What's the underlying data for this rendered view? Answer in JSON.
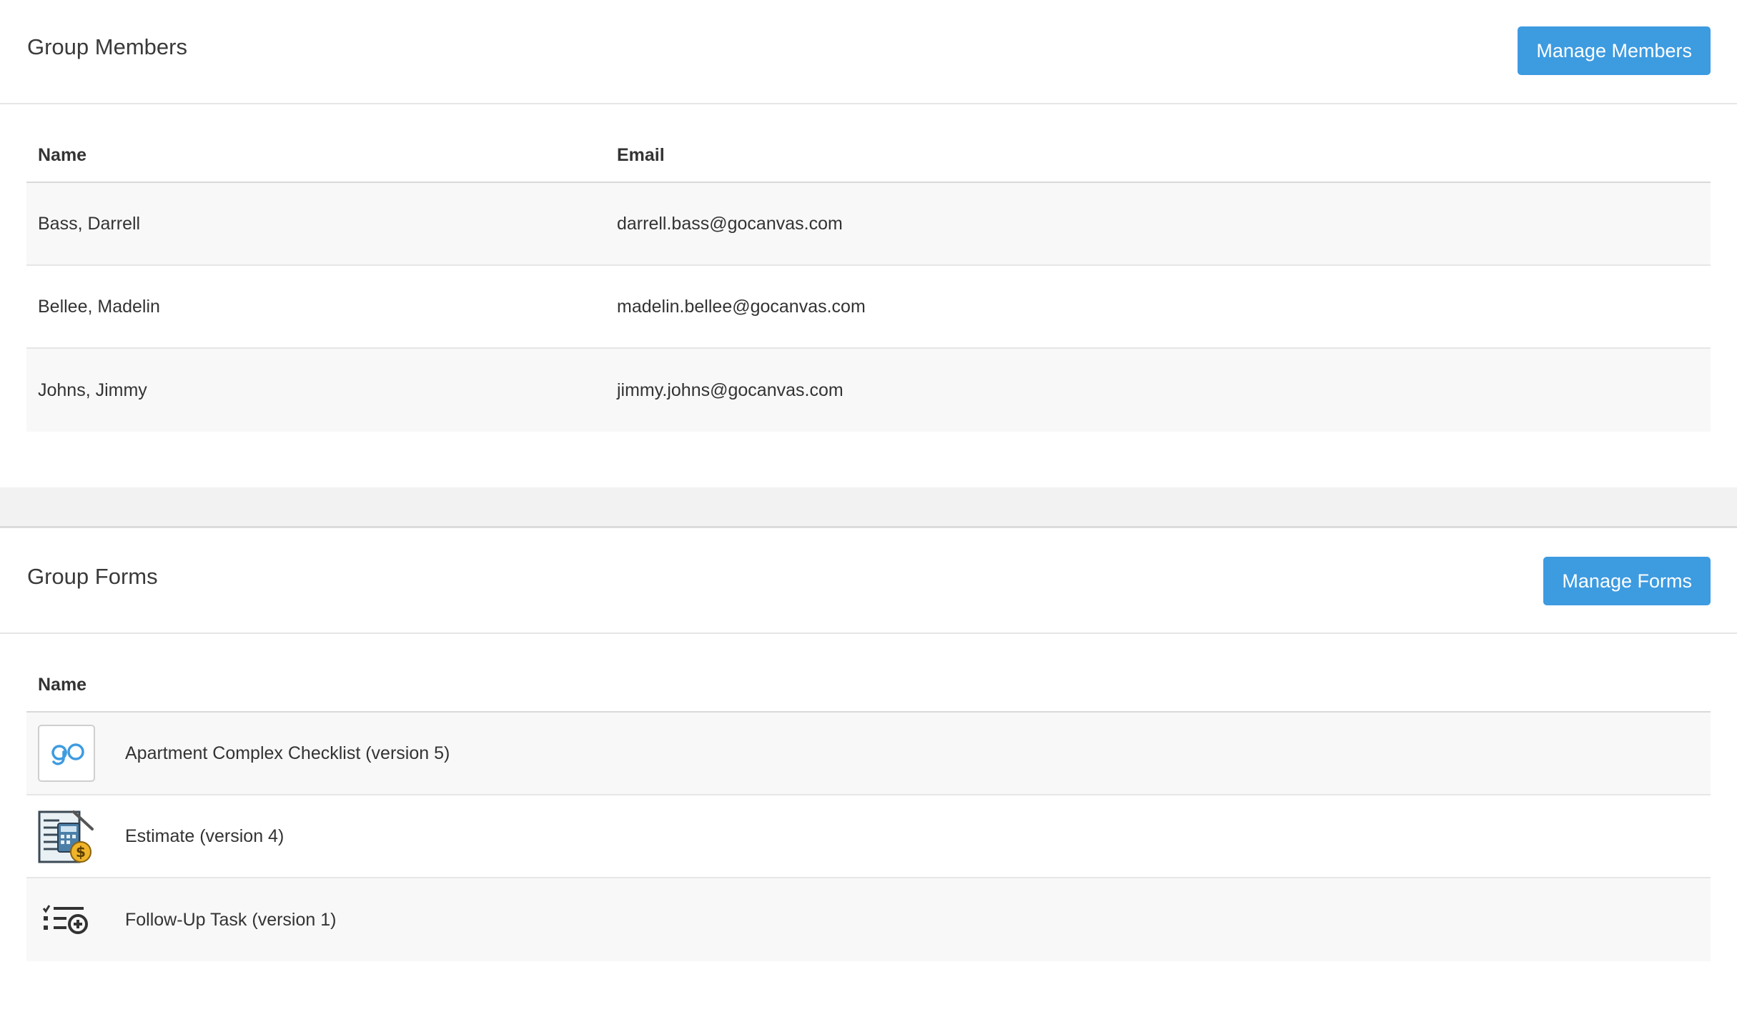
{
  "members": {
    "title": "Group Members",
    "manage_label": "Manage Members",
    "columns": {
      "name": "Name",
      "email": "Email"
    },
    "rows": [
      {
        "name": "Bass, Darrell",
        "email": "darrell.bass@gocanvas.com"
      },
      {
        "name": "Bellee, Madelin",
        "email": "madelin.bellee@gocanvas.com"
      },
      {
        "name": "Johns, Jimmy",
        "email": "jimmy.johns@gocanvas.com"
      }
    ]
  },
  "forms": {
    "title": "Group Forms",
    "manage_label": "Manage Forms",
    "columns": {
      "name": "Name"
    },
    "rows": [
      {
        "icon": "gocanvas-logo-icon",
        "name": "Apartment Complex Checklist (version 5)"
      },
      {
        "icon": "calculator-estimate-icon",
        "name": "Estimate (version 4)"
      },
      {
        "icon": "task-list-add-icon",
        "name": "Follow-Up Task (version 1)"
      }
    ]
  },
  "colors": {
    "button_blue": "#3d9be0",
    "row_alt": "#f8f8f8",
    "divider": "#e6e6e6"
  }
}
